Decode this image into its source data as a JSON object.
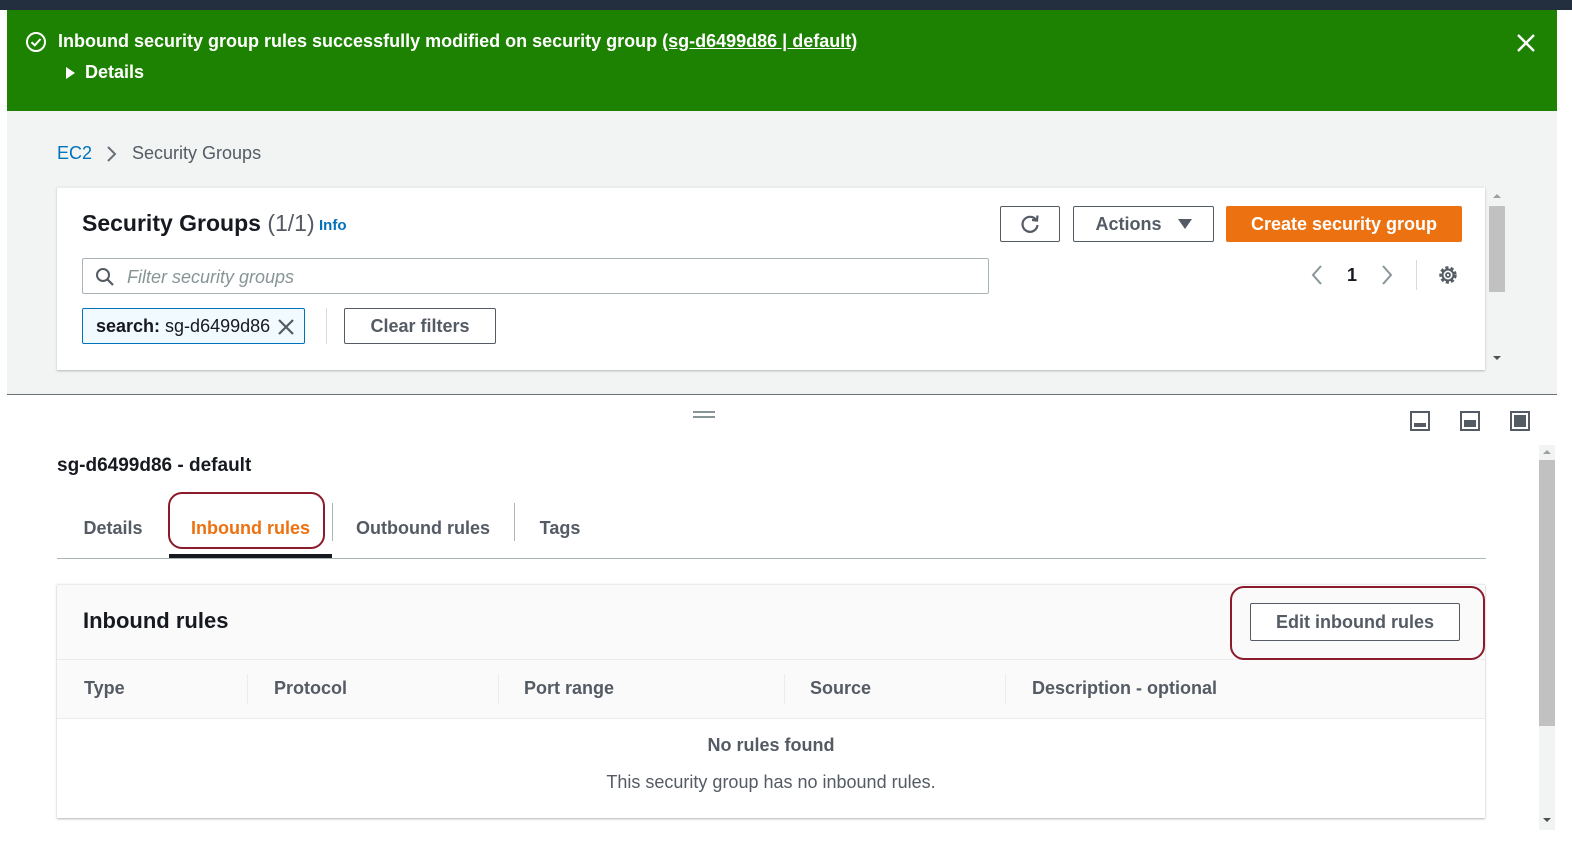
{
  "flash": {
    "message": "Inbound security group rules successfully modified on security group ",
    "link": "(sg-d6499d86 | default)",
    "details_label": "Details",
    "color": "#1d8102"
  },
  "breadcrumb": {
    "root": "EC2",
    "current": "Security Groups"
  },
  "security_groups": {
    "title": "Security Groups",
    "count": "(1/1)",
    "info": "Info",
    "actions_label": "Actions",
    "create_label": "Create security group",
    "filter_placeholder": "Filter security groups",
    "page": "1",
    "token_key": "search:",
    "token_value": "sg-d6499d86",
    "clear_label": "Clear filters"
  },
  "detail": {
    "title": "sg-d6499d86 - default",
    "tabs": [
      "Details",
      "Inbound rules",
      "Outbound rules",
      "Tags"
    ],
    "active_tab": "Inbound rules"
  },
  "inbound": {
    "title": "Inbound rules",
    "edit_label": "Edit inbound rules",
    "columns": [
      "Type",
      "Protocol",
      "Port range",
      "Source",
      "Description - optional"
    ],
    "empty_title": "No rules found",
    "empty_desc": "This security group has no inbound rules."
  },
  "colors": {
    "accent": "#ec7211",
    "link": "#0073bb",
    "highlight": "#8b1a2b"
  }
}
